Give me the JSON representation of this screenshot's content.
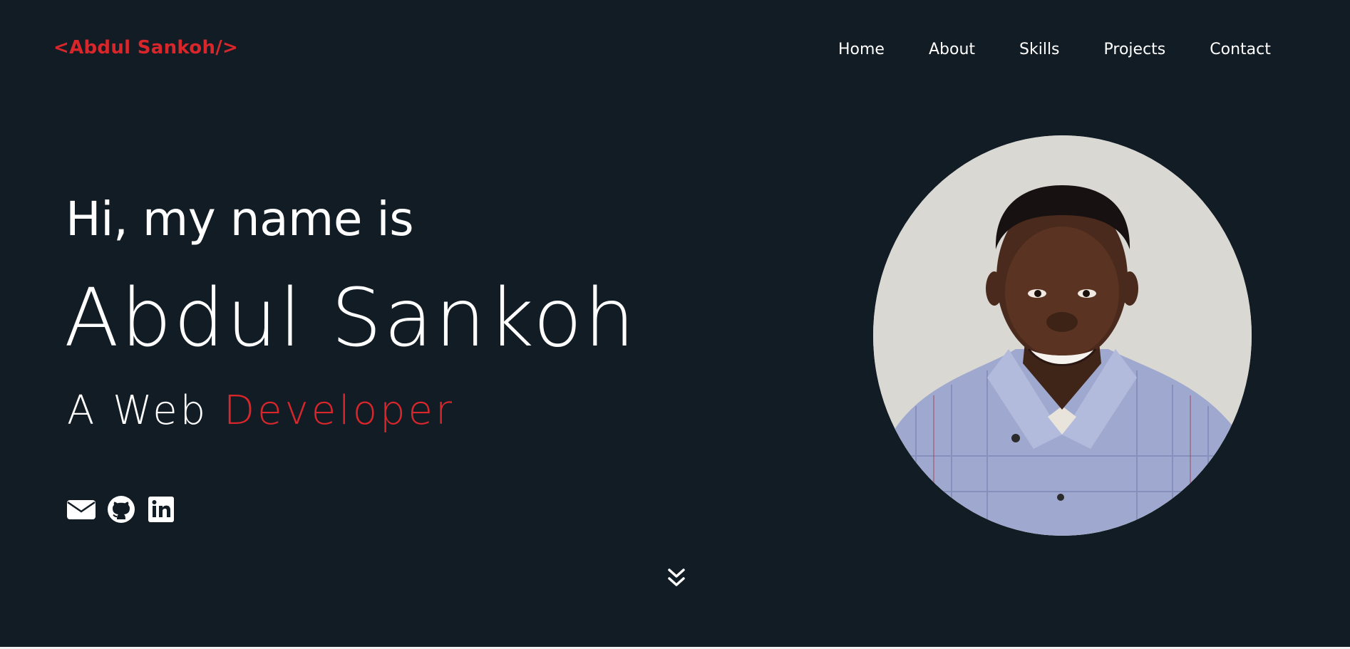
{
  "header": {
    "logo": "<Abdul Sankoh/>",
    "nav": [
      {
        "label": "Home"
      },
      {
        "label": "About"
      },
      {
        "label": "Skills"
      },
      {
        "label": "Projects"
      },
      {
        "label": "Contact"
      }
    ]
  },
  "hero": {
    "greeting": "Hi, my name is",
    "name": "Abdul Sankoh",
    "role_prefix": "A Web",
    "role_highlight": "Developer",
    "socials": [
      {
        "icon": "envelope-icon"
      },
      {
        "icon": "github-icon"
      },
      {
        "icon": "linkedin-icon"
      }
    ],
    "scroll_icon": "double-chevron-down-icon",
    "portrait_alt": "portrait-photo"
  },
  "colors": {
    "background": "#121c25",
    "accent": "#d8262b",
    "text": "#ffffff"
  }
}
